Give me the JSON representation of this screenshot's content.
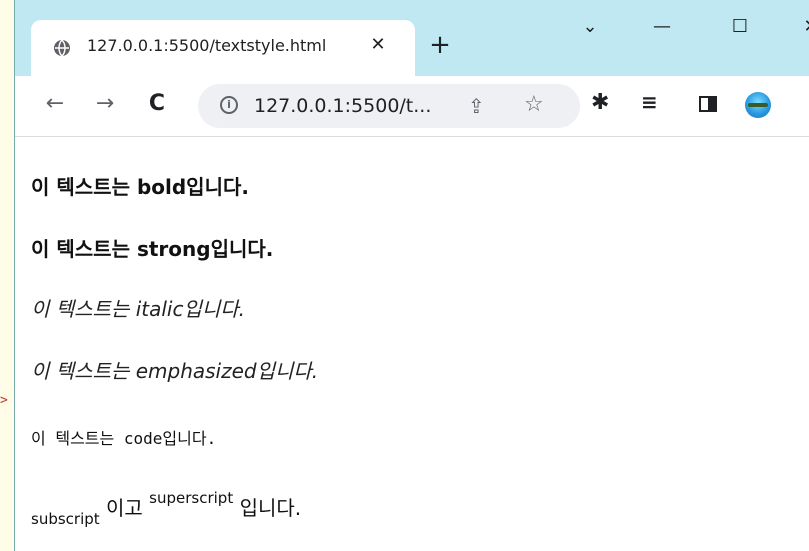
{
  "browser": {
    "tab_title": "127.0.0.1:5500/textstyle.html",
    "new_tab_symbol": "+",
    "url": "127.0.0.1:5500/t...",
    "icons": [
      "globe-icon",
      "close-icon",
      "plus-icon",
      "chevron-down-icon",
      "minimize-icon",
      "maximize-icon",
      "close-window-icon",
      "back-icon",
      "forward-icon",
      "reload-icon",
      "info-icon",
      "share-icon",
      "star-icon",
      "extensions-icon",
      "reading-list-icon",
      "side-panel-icon",
      "profile-avatar"
    ]
  },
  "page": {
    "line_bold": {
      "prefix": "이 텍스트는 ",
      "word": "bold",
      "suffix": "입니다."
    },
    "line_strong": {
      "prefix": "이 텍스트는 ",
      "word": "strong",
      "suffix": "입니다."
    },
    "line_italic": {
      "prefix": "이 텍스트는 ",
      "word": "italic",
      "suffix": "입니다."
    },
    "line_emphasized": {
      "prefix": "이 텍스트는 ",
      "word": "emphasized",
      "suffix": "입니다."
    },
    "line_code": {
      "prefix": "이 텍스트는 ",
      "word": "code",
      "suffix": "입니다."
    },
    "line_subsup": {
      "sub": "subscript",
      "middle": " 이고 ",
      "sup": "superscript",
      "suffix": " 입니다."
    }
  },
  "background": {
    "arrow_fragment": ">"
  }
}
